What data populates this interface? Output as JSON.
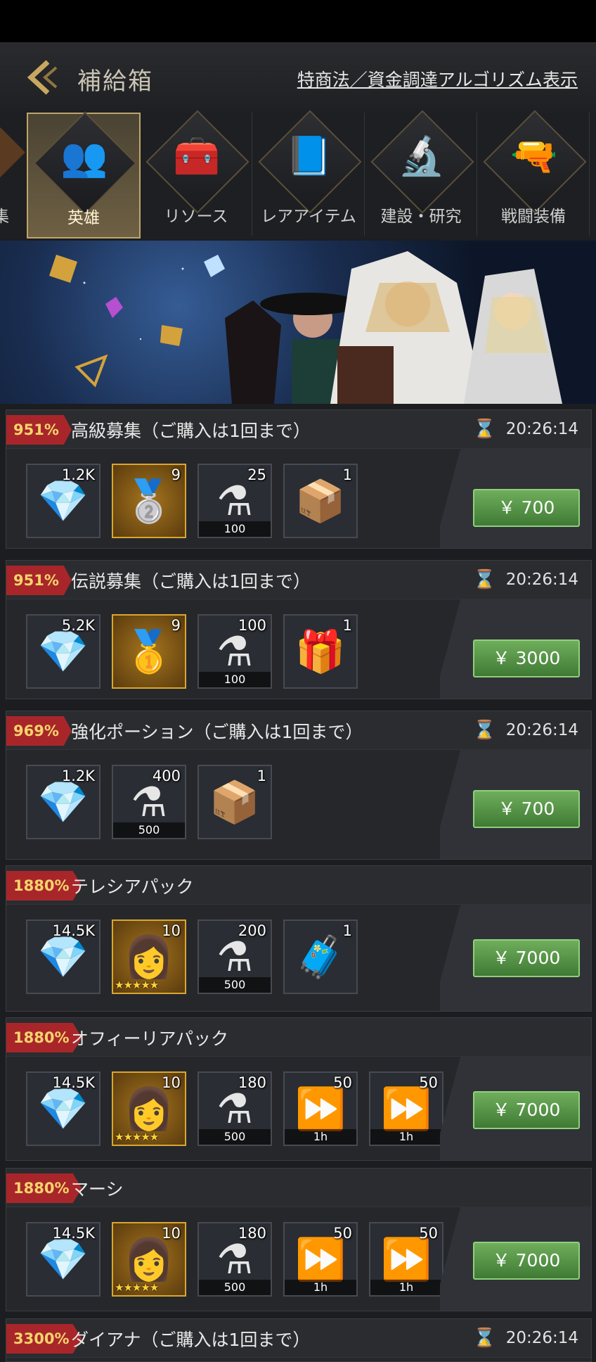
{
  "header": {
    "title": "補給箱",
    "legal_link": "特商法／資金調達アルゴリズム表示"
  },
  "tabs": [
    {
      "label": "英雄",
      "icon": "heroes-icon",
      "active": true
    },
    {
      "label": "リソース",
      "icon": "treasure-chest-icon",
      "active": false
    },
    {
      "label": "レアアイテム",
      "icon": "rare-items-icon",
      "active": false
    },
    {
      "label": "建設・研究",
      "icon": "microscope-icon",
      "active": false
    },
    {
      "label": "戦闘装備",
      "icon": "revolver-icon",
      "active": false
    }
  ],
  "partial_tab_label": "集",
  "packs": [
    {
      "badge": "951%",
      "name": "高級募集（ご購入は1回まで）",
      "timer": "20:26:14",
      "price": "￥ 700",
      "items": [
        {
          "icon": "diamond-icon",
          "count": "1.2K",
          "sub": ""
        },
        {
          "icon": "silver-medal-icon",
          "count": "9",
          "sub": ""
        },
        {
          "icon": "potion-icon",
          "count": "25",
          "sub": "100"
        },
        {
          "icon": "chest-ii-icon",
          "count": "1",
          "sub": ""
        }
      ]
    },
    {
      "badge": "951%",
      "name": "伝説募集（ご購入は1回まで）",
      "timer": "20:26:14",
      "price": "￥ 3000",
      "items": [
        {
          "icon": "diamond-icon",
          "count": "5.2K",
          "sub": ""
        },
        {
          "icon": "gold-medal-icon",
          "count": "9",
          "sub": ""
        },
        {
          "icon": "potion-icon",
          "count": "100",
          "sub": "100"
        },
        {
          "icon": "chest-iv-icon",
          "count": "1",
          "sub": ""
        }
      ]
    },
    {
      "badge": "969%",
      "name": "強化ポーション（ご購入は1回まで）",
      "timer": "20:26:14",
      "price": "￥ 700",
      "items": [
        {
          "icon": "diamond-icon",
          "count": "1.2K",
          "sub": ""
        },
        {
          "icon": "potion-icon",
          "count": "400",
          "sub": "500"
        },
        {
          "icon": "chest-ii-icon",
          "count": "1",
          "sub": ""
        }
      ]
    },
    {
      "badge": "1880%",
      "name": "テレシアパック",
      "timer": "",
      "price": "￥ 7000",
      "items": [
        {
          "icon": "diamond-icon",
          "count": "14.5K",
          "sub": ""
        },
        {
          "icon": "hero-shard-icon",
          "count": "10",
          "sub": "",
          "stars": "★★★★★"
        },
        {
          "icon": "potion-icon",
          "count": "200",
          "sub": "500"
        },
        {
          "icon": "chest-v-icon",
          "count": "1",
          "sub": ""
        }
      ]
    },
    {
      "badge": "1880%",
      "name": "オフィーリアパック",
      "timer": "",
      "price": "￥ 7000",
      "items": [
        {
          "icon": "diamond-icon",
          "count": "14.5K",
          "sub": ""
        },
        {
          "icon": "hero-shard-icon",
          "count": "10",
          "sub": "",
          "stars": "★★★★★"
        },
        {
          "icon": "potion-icon",
          "count": "180",
          "sub": "500"
        },
        {
          "icon": "speedup-icon",
          "count": "50",
          "sub": "1h"
        },
        {
          "icon": "speedup-target-icon",
          "count": "50",
          "sub": "1h"
        }
      ]
    },
    {
      "badge": "1880%",
      "name": "マーシ",
      "timer": "",
      "price": "￥ 7000",
      "items": [
        {
          "icon": "diamond-icon",
          "count": "14.5K",
          "sub": ""
        },
        {
          "icon": "hero-shard-icon",
          "count": "10",
          "sub": "",
          "stars": "★★★★★"
        },
        {
          "icon": "potion-icon",
          "count": "180",
          "sub": "500"
        },
        {
          "icon": "speedup-icon",
          "count": "50",
          "sub": "1h"
        },
        {
          "icon": "speedup-target-icon",
          "count": "50",
          "sub": "1h"
        }
      ]
    },
    {
      "badge": "3300%",
      "name": "ダイアナ（ご購入は1回まで）",
      "timer": "20:26:14",
      "price": "",
      "items": []
    }
  ]
}
